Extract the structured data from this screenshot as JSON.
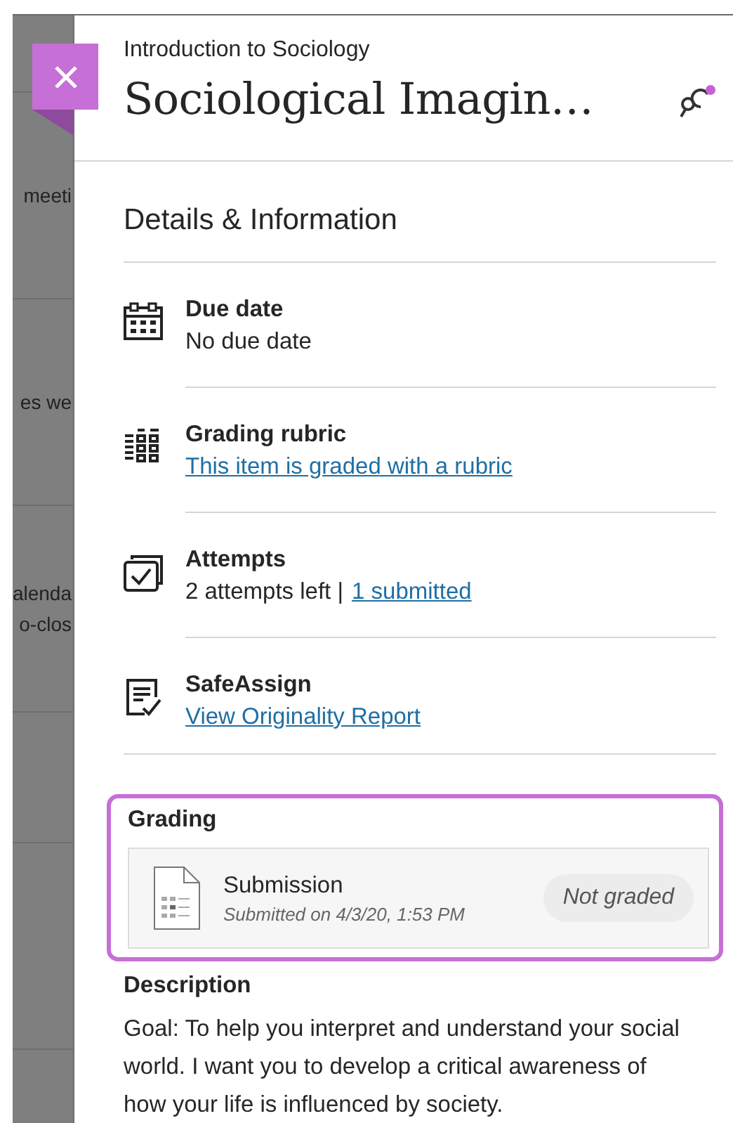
{
  "background_page": {
    "fragments": [
      {
        "lines": [
          "meeti"
        ]
      },
      {
        "lines": [
          "es we"
        ]
      },
      {
        "lines": [
          "alenda",
          "o-clos"
        ]
      }
    ]
  },
  "panel": {
    "course": "Introduction to Sociology",
    "title": "Sociological Imagin…",
    "section_title": "Details & Information",
    "details": [
      {
        "kind": "calendar",
        "label": "Due date",
        "value": "No due date"
      },
      {
        "kind": "rubric",
        "label": "Grading rubric",
        "link": "This item is graded with a rubric"
      },
      {
        "kind": "attempts",
        "label": "Attempts",
        "value": "2 attempts left |",
        "link": "1 submitted"
      },
      {
        "kind": "safeassign",
        "label": "SafeAssign",
        "link": "View Originality Report"
      }
    ],
    "grading": {
      "title": "Grading",
      "highlighted": true,
      "submission": {
        "title": "Submission",
        "date": "Submitted on 4/3/20, 1:53 PM",
        "status": "Not graded"
      }
    },
    "description": {
      "title": "Description",
      "text": "Goal: To help you interpret and understand your social world. I want you to develop a critical awareness of how your life is influenced by society."
    }
  }
}
